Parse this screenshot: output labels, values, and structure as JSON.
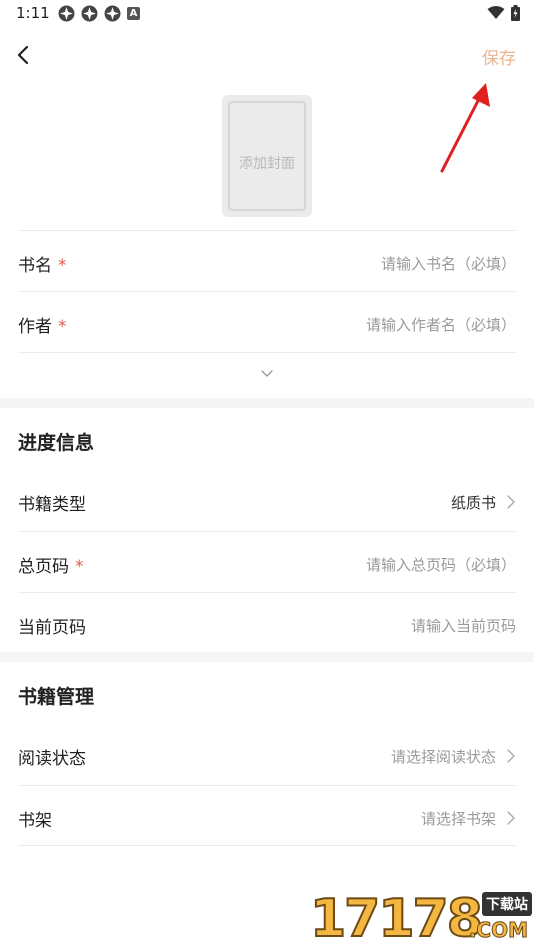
{
  "status_bar": {
    "time": "1:11",
    "badge_letter": "A"
  },
  "header": {
    "save_label": "保存"
  },
  "cover": {
    "label": "添加封面"
  },
  "basic": {
    "rows": [
      {
        "label": "书名",
        "required": "*",
        "placeholder": "请输入书名（必填）"
      },
      {
        "label": "作者",
        "required": "*",
        "placeholder": "请输入作者名（必填）"
      }
    ]
  },
  "progress": {
    "title": "进度信息",
    "book_type": {
      "label": "书籍类型",
      "value": "纸质书"
    },
    "total_pages": {
      "label": "总页码",
      "required": "*",
      "placeholder": "请输入总页码（必填）"
    },
    "current_page": {
      "label": "当前页码",
      "placeholder": "请输入当前页码"
    }
  },
  "management": {
    "title": "书籍管理",
    "reading_status": {
      "label": "阅读状态",
      "placeholder": "请选择阅读状态"
    },
    "shelf": {
      "label": "书架",
      "placeholder": "请选择书架"
    }
  },
  "watermark": {
    "number": "17178",
    "badge": "下载站",
    "domain": ".COM"
  },
  "colors": {
    "accent": "#eab48f",
    "required": "#e25b4b",
    "annotation": "#e02020"
  }
}
